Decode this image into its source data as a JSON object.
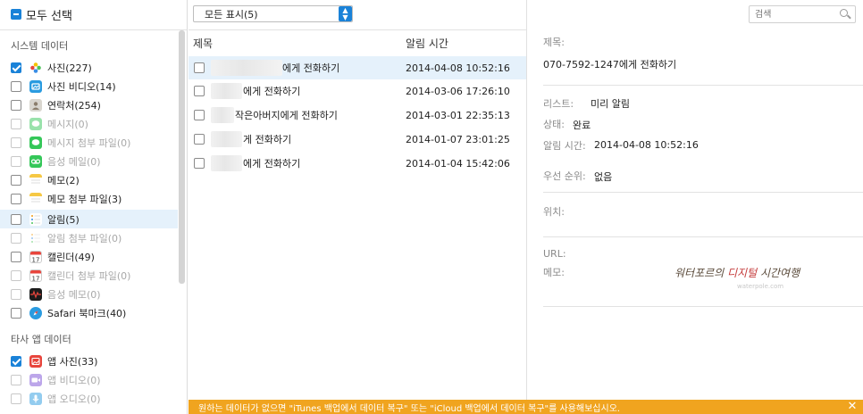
{
  "sidebar": {
    "select_all_label": "모두 선택",
    "system_group_title": "시스템 데이터",
    "thirdparty_group_title": "타사 앱 데이터",
    "system_items": [
      {
        "label": "사진(227)",
        "icon": "photos-icon",
        "checked": true,
        "dim": false
      },
      {
        "label": "사진 비디오(14)",
        "icon": "photo-video-icon",
        "checked": false,
        "dim": false
      },
      {
        "label": "연락처(254)",
        "icon": "contacts-icon",
        "checked": false,
        "dim": false
      },
      {
        "label": "메시지(0)",
        "icon": "messages-icon",
        "checked": false,
        "dim": true
      },
      {
        "label": "메시지 첨부 파일(0)",
        "icon": "message-attachment-icon",
        "checked": false,
        "dim": true
      },
      {
        "label": "음성 메일(0)",
        "icon": "voicemail-icon",
        "checked": false,
        "dim": true
      },
      {
        "label": "메모(2)",
        "icon": "notes-icon",
        "checked": false,
        "dim": false
      },
      {
        "label": "메모 첨부 파일(3)",
        "icon": "notes-attachment-icon",
        "checked": false,
        "dim": false
      },
      {
        "label": "알림(5)",
        "icon": "reminders-icon",
        "checked": false,
        "dim": false,
        "selected": true
      },
      {
        "label": "알림 첨부 파일(0)",
        "icon": "reminders-attachment-icon",
        "checked": false,
        "dim": true
      },
      {
        "label": "캘린더(49)",
        "icon": "calendar-icon",
        "checked": false,
        "dim": false
      },
      {
        "label": "캘린더 첨부 파일(0)",
        "icon": "calendar-attachment-icon",
        "checked": false,
        "dim": true
      },
      {
        "label": "음성 메모(0)",
        "icon": "voice-memo-icon",
        "checked": false,
        "dim": true
      },
      {
        "label": "Safari 북마크(40)",
        "icon": "safari-icon",
        "checked": false,
        "dim": false
      }
    ],
    "thirdparty_items": [
      {
        "label": "앱 사진(33)",
        "icon": "app-photos-icon",
        "checked": true,
        "dim": false
      },
      {
        "label": "앱 비디오(0)",
        "icon": "app-video-icon",
        "checked": false,
        "dim": true
      },
      {
        "label": "앱 오디오(0)",
        "icon": "app-audio-icon",
        "checked": false,
        "dim": true
      }
    ]
  },
  "toolbar": {
    "filter_value": "모든 표시(5)",
    "search_placeholder": "검색"
  },
  "list": {
    "col_title": "제목",
    "col_time": "알림 시간",
    "rows": [
      {
        "title": "에게 전화하기",
        "time": "2014-04-08 10:52:16",
        "selected": true
      },
      {
        "title": "에게 전화하기",
        "time": "2014-03-06 17:26:10",
        "selected": false
      },
      {
        "title": "작은아버지에게 전화하기",
        "time": "2014-03-01 22:35:13",
        "selected": false
      },
      {
        "title": "게 전화하기",
        "time": "2014-01-07 23:01:25",
        "selected": false
      },
      {
        "title": "에게 전화하기",
        "time": "2014-01-04 15:42:06",
        "selected": false
      }
    ]
  },
  "detail": {
    "title_label": "제목:",
    "title_value": "070-7592-1247에게 전화하기",
    "list_label": "리스트:",
    "list_value": "미리 알림",
    "status_label": "상태:",
    "status_value": "완료",
    "alarm_label": "알림 시간:",
    "alarm_value": "2014-04-08 10:52:16",
    "priority_label": "우선 순위:",
    "priority_value": "없음",
    "location_label": "위치:",
    "url_label": "URL:",
    "memo_label": "메모:",
    "watermark_main_a": "워터포르의 ",
    "watermark_main_b": "디지털",
    "watermark_main_c": " 시간여행",
    "watermark_sub": "waterpole.com"
  },
  "notice": {
    "message": "원하는 데이터가 없으면 \"iTunes 백업에서 데이터 복구\" 또는 \"iCloud 백업에서 데이터 복구\"를 사용해보십시오.",
    "close_glyph": "✕"
  },
  "colors": {
    "accent": "#1a82d8",
    "notice_bg": "#f0a41f",
    "selection_bg": "#e5f1fb"
  }
}
